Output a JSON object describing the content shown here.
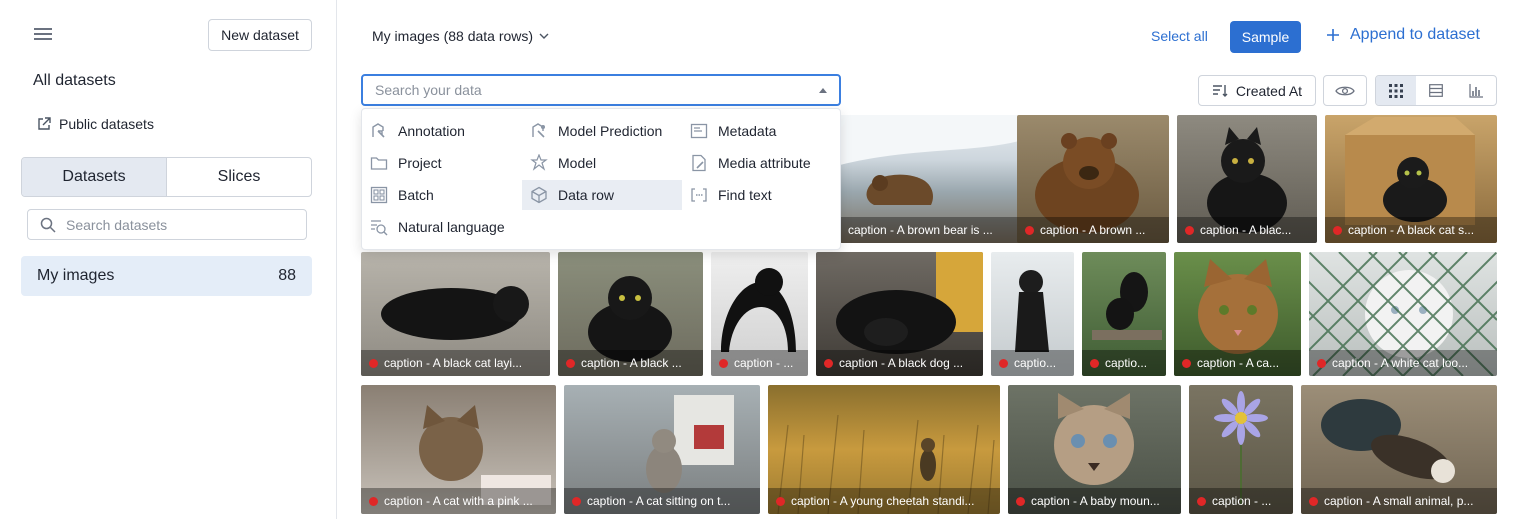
{
  "sidebar": {
    "new_dataset": "New dataset",
    "all_datasets": "All datasets",
    "public_datasets": "Public datasets",
    "tabs": [
      "Datasets",
      "Slices"
    ],
    "search_placeholder": "Search datasets",
    "dataset_name": "My images",
    "dataset_count": "88"
  },
  "header": {
    "title": "My images (88 data rows)",
    "select_all": "Select all",
    "sample": "Sample",
    "append": "Append to dataset",
    "sort_label": "Created At",
    "search_placeholder": "Search your data"
  },
  "filter_options": {
    "annotation": "Annotation",
    "model_prediction": "Model Prediction",
    "metadata": "Metadata",
    "project": "Project",
    "model": "Model",
    "media_attribute": "Media attribute",
    "batch": "Batch",
    "data_row": "Data row",
    "find_text": "Find text",
    "natural_language": "Natural language"
  },
  "captions": {
    "r1": [
      "caption - A brown bear is ...",
      "caption - A brown ...",
      "caption - A blac...",
      "caption - A black cat s..."
    ],
    "r2": [
      "caption - A black cat layi...",
      "caption - A black ...",
      "caption - ...",
      "caption - A black dog ...",
      "captio...",
      "captio...",
      "caption - A ca...",
      "caption - A white cat loo..."
    ],
    "r3": [
      "caption - A cat with a pink ...",
      "caption - A cat sitting on t...",
      "caption - A young cheetah standi...",
      "caption - A baby moun...",
      "caption - ...",
      "caption - A small animal, p..."
    ]
  },
  "colors": {
    "accent": "#2c6fd1",
    "selected_bg": "#e4edf8",
    "status_dot": "#e02727"
  }
}
